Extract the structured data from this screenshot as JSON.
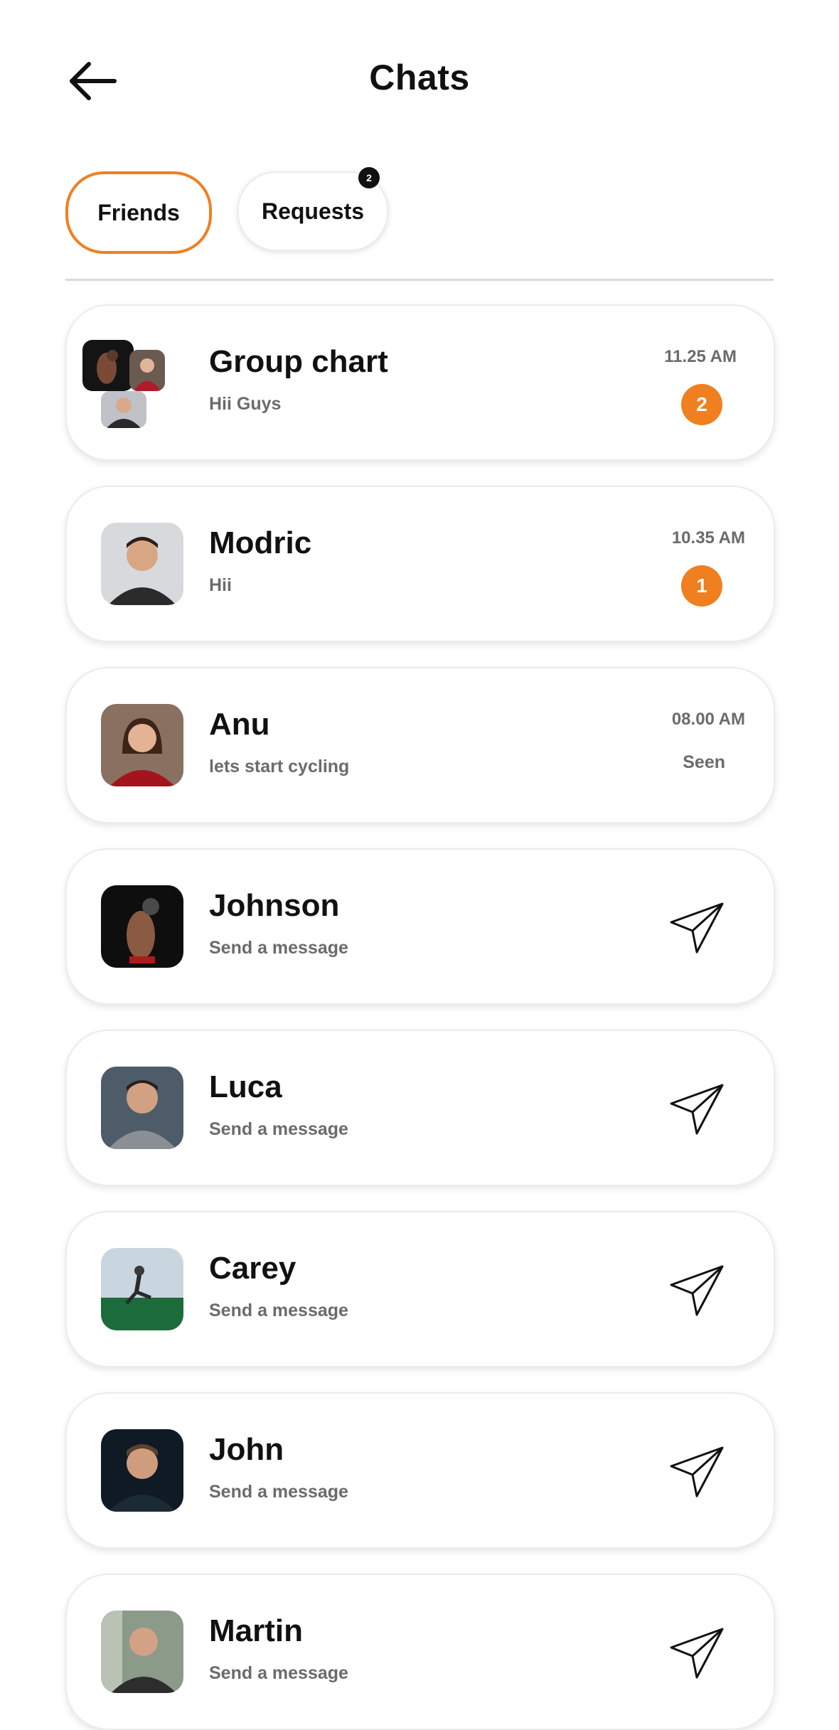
{
  "header": {
    "title": "Chats"
  },
  "tabs": [
    {
      "label": "Friends",
      "active": true
    },
    {
      "label": "Requests",
      "active": false,
      "badge": "2"
    }
  ],
  "chats": [
    {
      "name": "Group chart",
      "message": "Hii Guys",
      "time": "11.25 AM",
      "unread": "2"
    },
    {
      "name": "Modric",
      "message": "Hii",
      "time": "10.35 AM",
      "unread": "1"
    },
    {
      "name": "Anu",
      "message": "lets start cycling",
      "time": "08.00 AM",
      "status": "Seen"
    },
    {
      "name": "Johnson",
      "message": "Send a message"
    },
    {
      "name": "Luca",
      "message": "Send a message"
    },
    {
      "name": "Carey",
      "message": "Send a message"
    },
    {
      "name": "John",
      "message": "Send a message"
    },
    {
      "name": "Martin",
      "message": "Send a message"
    }
  ],
  "colors": {
    "accent": "#f07f1f",
    "text": "#111111",
    "muted": "#6b6b6b"
  }
}
